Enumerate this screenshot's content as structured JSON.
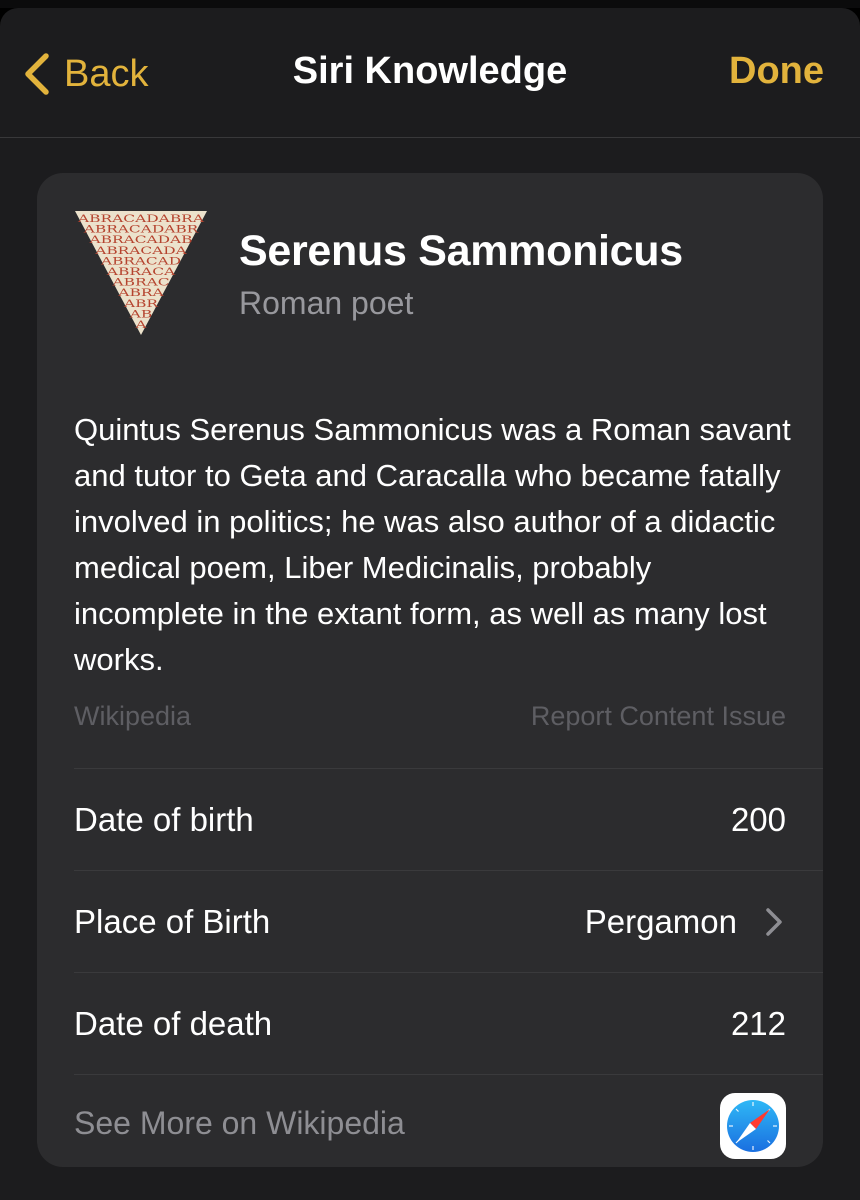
{
  "navbar": {
    "back_label": "Back",
    "title": "Siri Knowledge",
    "done_label": "Done"
  },
  "entity": {
    "name": "Serenus Sammonicus",
    "type": "Roman poet",
    "image_text": [
      "ABRACADABRA",
      "ABRACADABR",
      "ABRACADAB",
      "ABRACADA",
      "ABRACAD",
      "ABRACA",
      "ABRAC",
      "ABRA",
      "ABR",
      "AB",
      "A"
    ],
    "description": "Quintus Serenus Sammonicus was a Roman savant and tutor to Geta and Caracalla who became fatally involved in politics; he was also author of a didactic medical poem, Liber Medicinalis, probably incomplete in the extant form, as well as many lost works.",
    "source": "Wikipedia",
    "report_label": "Report Content Issue"
  },
  "facts": [
    {
      "label": "Date of birth",
      "value": "200"
    },
    {
      "label": "Place of Birth",
      "value": "Pergamon"
    },
    {
      "label": "Date of death",
      "value": "212"
    }
  ],
  "footer": {
    "see_more_label": "See More on Wikipedia",
    "icon": "safari-compass-icon"
  },
  "colors": {
    "accent": "#e2b33c",
    "background": "#1c1c1e",
    "card": "#2c2c2e",
    "secondary_text": "#98989d"
  }
}
